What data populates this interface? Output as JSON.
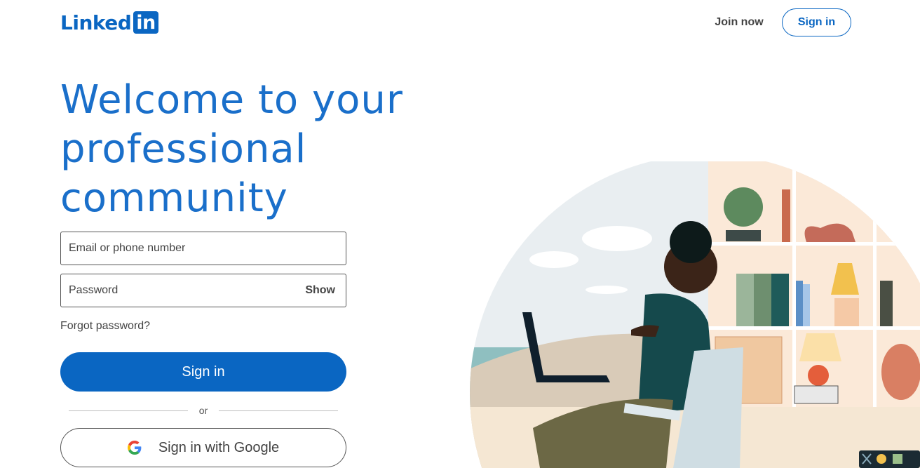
{
  "header": {
    "logo_text": "Linked",
    "logo_box_text": "in",
    "join_now": "Join now",
    "sign_in": "Sign in"
  },
  "hero": {
    "headline_line1": "Welcome to your",
    "headline_line2": "professional",
    "headline_line3": "community"
  },
  "form": {
    "email_placeholder": "Email or phone number",
    "password_placeholder": "Password",
    "show_label": "Show",
    "forgot_password": "Forgot password?",
    "sign_in_button": "Sign in",
    "or_divider": "or",
    "google_button": "Sign in with Google"
  },
  "colors": {
    "brand": "#0a66c2",
    "headline": "#1a6fca"
  },
  "icons": {
    "google": "google-g-icon"
  }
}
